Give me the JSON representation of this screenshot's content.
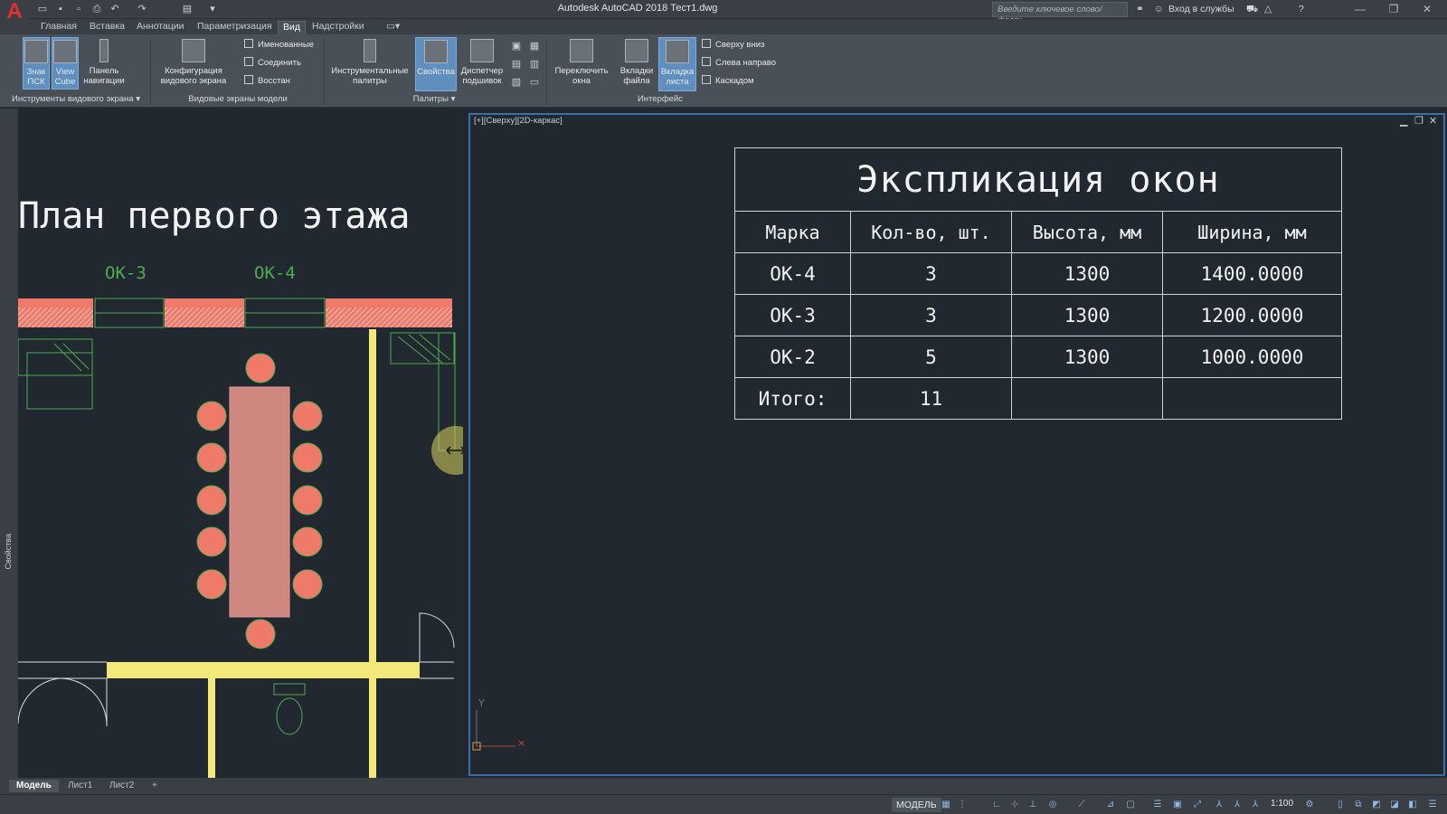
{
  "titlebar": {
    "app_logo": "A",
    "title": "Autodesk AutoCAD 2018    Тест1.dwg",
    "search_placeholder": "Введите ключевое слово/фразу",
    "signin": "Вход в службы"
  },
  "ribbon_tabs": [
    "Главная",
    "Вставка",
    "Аннотации",
    "Параметризация",
    "Вид",
    "Надстройки"
  ],
  "ribbon": {
    "ucs_icon": "Знак ПСК",
    "view_cube": "View Cube",
    "nav_panel": "Панель навигации",
    "viewport_config": "Конфигурация видового экрана",
    "named": "Именованные",
    "join": "Соединить",
    "restore": "Восстан",
    "tool_palettes": "Инструментальные палитры",
    "properties": "Свойства",
    "sheet_set": "Диспетчер подшивок",
    "switch_windows": "Переключить окна",
    "file_tabs": "Вкладки файла",
    "layout_tabs": "Вкладка листа",
    "tile_h": "Сверху вниз",
    "tile_v": "Слева направо",
    "cascade": "Каскадом",
    "panel_viewport_tools": "Инструменты видового экрана",
    "panel_model_viewports": "Видовые экраны модели",
    "panel_palettes": "Палитры",
    "panel_interface": "Интерфейс"
  },
  "side_palette_label": "Свойства",
  "left_view": {
    "plan_title": "План первого этажа",
    "window_tag_1": "ОК-3",
    "window_tag_2": "ОК-4"
  },
  "right_view": {
    "viewport_label": "[+][Сверху][2D-каркас]",
    "axis_y": "Y",
    "schedule": {
      "title": "Экспликация окон",
      "headers": [
        "Марка",
        "Кол-во, шт.",
        "Высота, мм",
        "Ширина, мм"
      ],
      "rows": [
        [
          "ОК-4",
          "3",
          "1300",
          "1400.0000"
        ],
        [
          "ОК-3",
          "3",
          "1300",
          "1200.0000"
        ],
        [
          "ОК-2",
          "5",
          "1300",
          "1000.0000"
        ],
        [
          "Итого:",
          "11",
          "",
          ""
        ]
      ]
    }
  },
  "layout_tabs": [
    "Модель",
    "Лист1",
    "Лист2",
    "+"
  ],
  "statusbar": {
    "model": "МОДЕЛЬ",
    "scale": "1:100"
  },
  "colors": {
    "canvas": "#212830",
    "wall_red": "#f07a6a",
    "chair": "#ef7a69",
    "table": "#cf8780",
    "yellow_wall": "#f3e97a",
    "cad_green": "#4cae4f",
    "viewport_border": "#3c6ea8"
  }
}
